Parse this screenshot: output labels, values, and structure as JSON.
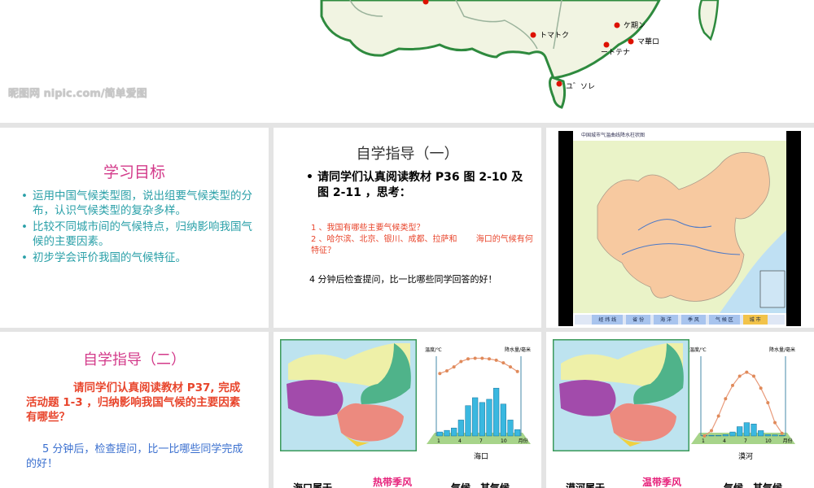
{
  "slide1": {
    "watermark": "昵图网 nipic.com/简单爱图",
    "cities": [
      "トマトク",
      "ケ期ン",
      "マ華ロ",
      "ートテナ",
      "ユ゛ソレ"
    ]
  },
  "slide2": {
    "title": "学习目标",
    "bullets": [
      "运用中国气候类型图，说出组要气候类型的分布，认识气候类型的复杂多样。",
      "比较不同城市间的气候特点，归纳影响我国气候的主要因素。",
      "初步学会评价我国的气候特征。"
    ]
  },
  "slide3": {
    "title": "自学指导（一）",
    "main": "请同学们认真阅读教材 P36 图 2-10 及图 2-11 ，思考：",
    "q1": "1 、我国有哪些主要气候类型？",
    "q2": "2 、哈尔滨、北京、银川、成都、拉萨和　　 海口的气候有何特征？",
    "footer": "4 分钟后检查提问，比一比哪些同学回答的好！"
  },
  "slide4": {
    "window_title": "中国城市气温曲线降水柱状图",
    "buttons": [
      "经 纬 线",
      "省 份",
      "海 洋",
      "季 风",
      "气 候 区",
      "城 市"
    ],
    "active": "城 市"
  },
  "slide5": {
    "title": "自学指导（二）",
    "para1": "请同学们认真阅读教材 P37, 完成活动题 1-3 ，归纳影响我国气候的主要因素有哪些？",
    "para2": "5 分钟后，检查提问，比一比哪些同学完成的好！"
  },
  "slide6": {
    "cap_a": "海口属于",
    "answer": "热带季风",
    "cap_b": "气候，其气候"
  },
  "slide7": {
    "cap_a": "漠河属于",
    "answer": "温带季风",
    "cap_b": "气候，其气候"
  },
  "chart_data": [
    {
      "type": "bar+line",
      "title": "海口",
      "ylabel_left": "温度/℃",
      "ylabel_right": "降水量/毫米",
      "x_ticks": [
        "1",
        "4",
        "7",
        "10",
        "月份"
      ],
      "temp_range": [
        -30,
        30
      ],
      "precip_range": [
        0,
        500
      ],
      "temperature": [
        17,
        19,
        22,
        26,
        28,
        28.5,
        28.5,
        28,
        27,
        25,
        22,
        18.5
      ],
      "precipitation": [
        25,
        35,
        50,
        100,
        190,
        240,
        210,
        230,
        300,
        200,
        100,
        40
      ]
    },
    {
      "type": "bar+line",
      "title": "漠河",
      "ylabel_left": "温度/℃",
      "ylabel_right": "降水量/毫米",
      "x_ticks": [
        "1",
        "4",
        "7",
        "10",
        "月份"
      ],
      "temp_range": [
        -30,
        30
      ],
      "precip_range": [
        0,
        600
      ],
      "temperature": [
        -30,
        -26,
        -15,
        -2,
        8,
        15,
        18,
        15,
        6,
        -5,
        -20,
        -28
      ],
      "precipitation": [
        5,
        5,
        5,
        10,
        30,
        70,
        100,
        90,
        40,
        10,
        8,
        5
      ]
    }
  ]
}
